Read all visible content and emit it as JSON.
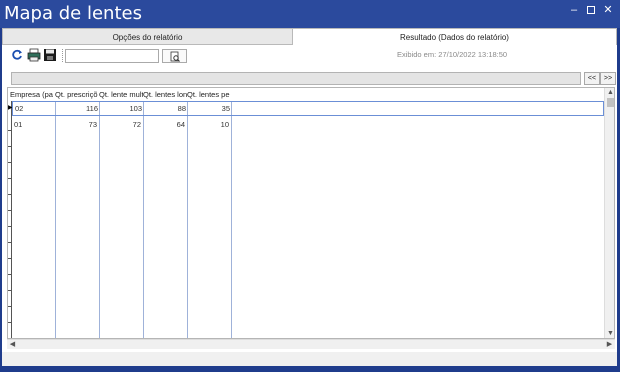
{
  "window": {
    "title": "Mapa de lentes",
    "minimize_glyph": "–",
    "close_glyph": "✕"
  },
  "tabs": [
    {
      "label": "Opções do relatório",
      "active": false
    },
    {
      "label": "Resultado (Dados do relatório)",
      "active": true
    }
  ],
  "exibido": "Exibido em: 27/10/2022 13:18:50",
  "toolbar": {
    "icons": [
      "refresh-icon",
      "print-icon",
      "save-icon",
      "find-icon"
    ],
    "search_value": ""
  },
  "pager": {
    "prev_label": "<<",
    "next_label": ">>"
  },
  "grid": {
    "columns": [
      "Empresa (pa",
      "Qt. prescriçõ",
      "Qt. lente mult",
      "Qt. lentes lon",
      "Qt. lentes pe"
    ],
    "rows": [
      [
        "02",
        "116",
        "103",
        "88",
        "35"
      ],
      [
        "01",
        "73",
        "72",
        "64",
        "10"
      ]
    ],
    "selected_row": 0,
    "row_pointer_glyph": "▶"
  },
  "colors": {
    "titlebar": "#2b4a9d",
    "selection_border": "#6b8fd6",
    "grid_lines": "#9fb2d9"
  }
}
